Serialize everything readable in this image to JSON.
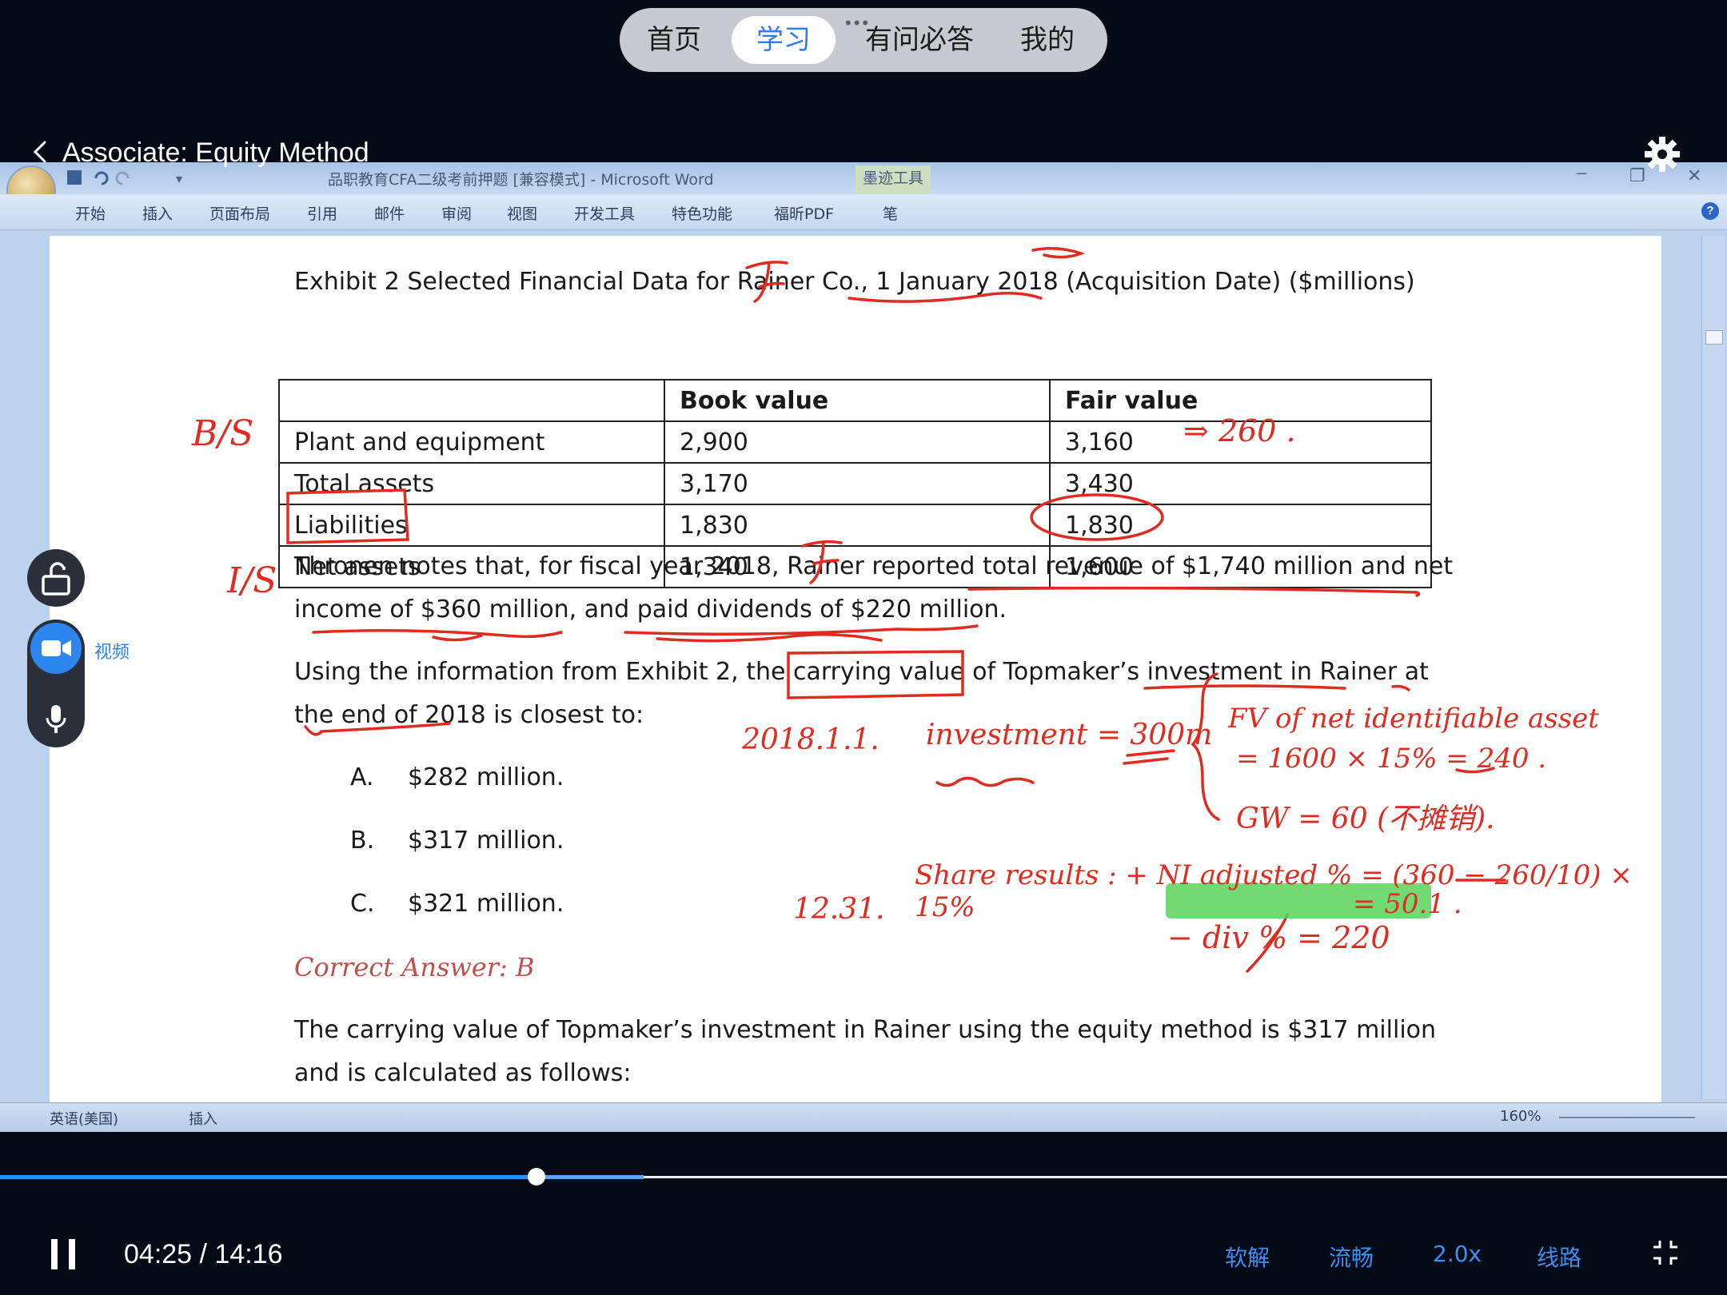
{
  "topnav": {
    "tabs": [
      "首页",
      "学习",
      "有问必答",
      "我的"
    ],
    "active": "学习"
  },
  "course": {
    "title": "Associate: Equity Method"
  },
  "word": {
    "window_title": "品职教育CFA二级考前押题 [兼容模式] - Microsoft Word",
    "ink_tools": "墨迹工具",
    "ribbon_tabs": [
      "开始",
      "插入",
      "页面布局",
      "引用",
      "邮件",
      "审阅",
      "视图",
      "开发工具",
      "特色功能",
      "福昕PDF",
      "笔"
    ],
    "status": {
      "language": "英语(美国)",
      "mode": "插入",
      "zoom": "160%"
    }
  },
  "document": {
    "exhibit_title": "Exhibit 2 Selected Financial Data for Rainer Co., 1 January 2018 (Acquisition Date) ($millions)",
    "table": {
      "headers": [
        "",
        "Book value",
        "Fair value"
      ],
      "rows": [
        [
          "Plant and equipment",
          "2,900",
          "3,160"
        ],
        [
          "Total assets",
          "3,170",
          "3,430"
        ],
        [
          "Liabilities",
          "1,830",
          "1,830"
        ],
        [
          "Net assets",
          "1,340",
          "1,600"
        ]
      ]
    },
    "para1_line1": "Thronen notes that, for fiscal year 2018, Rainer reported total revenue of $1,740 million and net",
    "para1_line2": "income of $360 million, and paid dividends of $220 million.",
    "question_line1": "Using the information from Exhibit 2, the carrying value of Topmaker’s investment in Rainer at",
    "question_line2": "the end of 2018 is closest to:",
    "options": [
      {
        "letter": "A.",
        "text": "$282 million."
      },
      {
        "letter": "B.",
        "text": "$317 million."
      },
      {
        "letter": "C.",
        "text": "$321 million."
      }
    ],
    "correct_answer": "Correct Answer: B",
    "expl_line1": "The carrying value of Topmaker’s investment in Rainer using the equity method is $317 million",
    "expl_line2": "and is calculated as follows:"
  },
  "annotations": {
    "bs": "B/S",
    "is": "I/S",
    "plant_diff": "⇒ 260 .",
    "date1": "2018.1.1.",
    "investment": "investment = 300m",
    "fv": "FV of net identifiable asset",
    "fv_calc": "= 1600 × 15% = 240 .",
    "gw": "GW = 60 (不摊销).",
    "date2": "12.31.",
    "share_results": "Share results : + NI adjusted % = (360 − 260/10) × 15%",
    "share_value": "= 50.1 .",
    "div": "− div % = 220",
    "ink_color": "#e02b20",
    "highlight_color": "#5bd35b"
  },
  "side": {
    "video_label": "视频"
  },
  "player": {
    "time": "04:25 / 14:16",
    "progress": 0.31,
    "controls": [
      "软解",
      "流畅",
      "2.0x",
      "线路"
    ]
  },
  "colors": {
    "accent": "#2d7cf2",
    "background": "#050a17"
  }
}
